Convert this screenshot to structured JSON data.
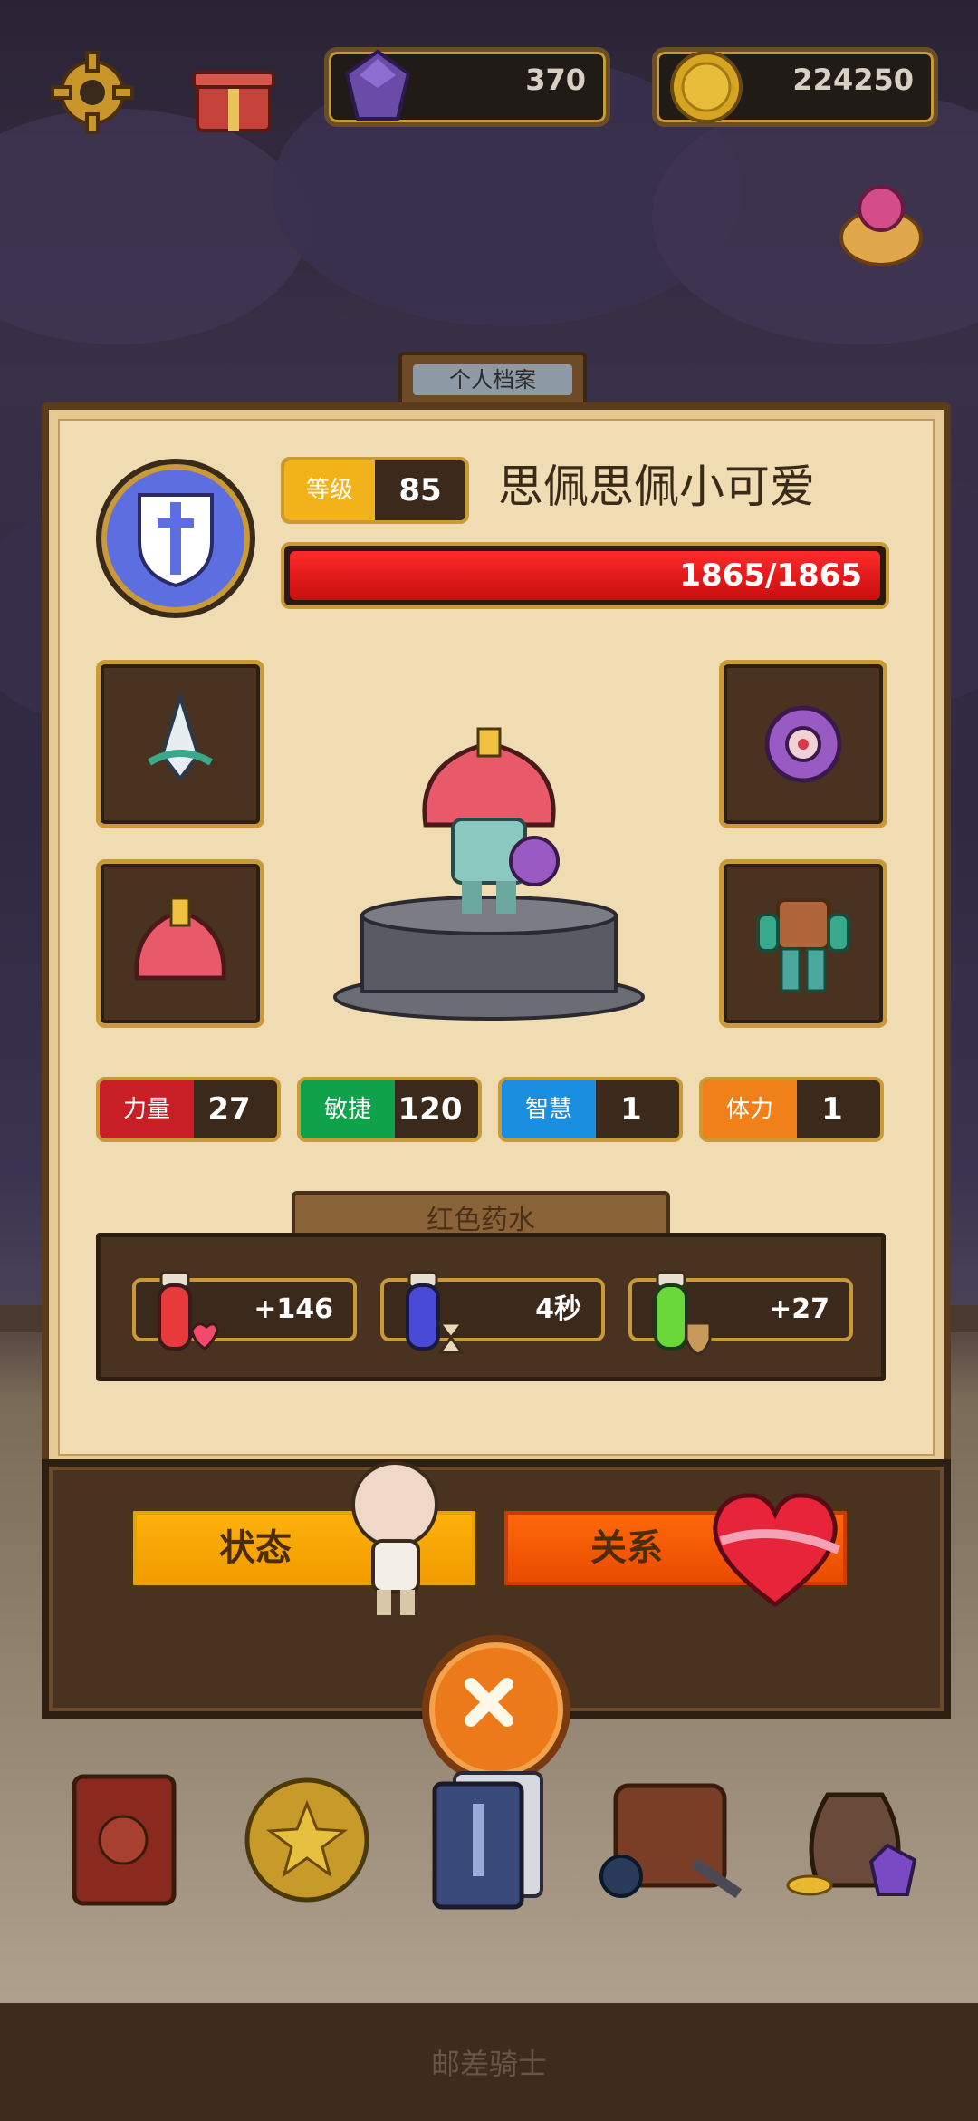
{
  "hud": {
    "gems": "370",
    "coins": "224250",
    "icons": [
      "gear-icon",
      "gift-icon",
      "gem-icon",
      "coin-icon",
      "treasure-pot-icon"
    ]
  },
  "profile": {
    "tab_title": "个人档案",
    "level_label": "等级",
    "level_value": "85",
    "player_name": "思佩思佩小可爱",
    "hp_text": "1865/1865",
    "hp_fraction": 1.0
  },
  "equipment": {
    "slots": [
      "spear-tip-icon",
      "shuriken-icon",
      "helmet-icon",
      "armor-icon"
    ]
  },
  "stats": [
    {
      "label": "力量",
      "value": "27",
      "color": "#c81e26"
    },
    {
      "label": "敏捷",
      "value": "120",
      "color": "#10a24a"
    },
    {
      "label": "智慧",
      "value": "1",
      "color": "#1a8fe0"
    },
    {
      "label": "体力",
      "value": "1",
      "color": "#f0801a"
    }
  ],
  "potions": {
    "title": "红色药水",
    "items": [
      {
        "icon": "red-potion-heart-icon",
        "value": "+146"
      },
      {
        "icon": "blue-potion-hourglass-icon",
        "value": "4秒"
      },
      {
        "icon": "green-potion-shield-icon",
        "value": "+27"
      }
    ]
  },
  "buttons": {
    "status_label": "状态",
    "relation_label": "关系"
  },
  "dock": {
    "items": [
      "spellbook-icon",
      "star-coin-icon",
      "card-deck-icon",
      "backpack-icon",
      "loot-bag-icon"
    ]
  },
  "footer": {
    "title": "邮差骑士"
  }
}
